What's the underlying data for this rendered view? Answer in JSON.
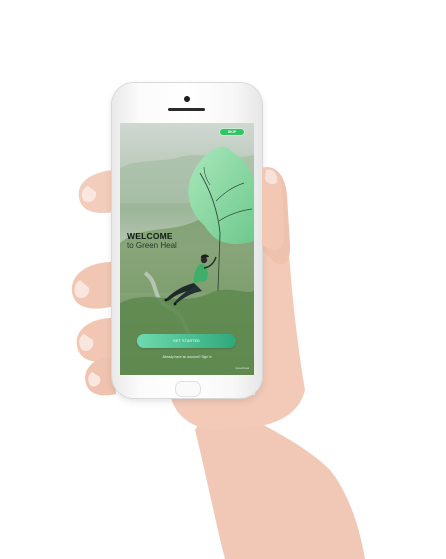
{
  "screen": {
    "skip_label": "SKIP",
    "welcome_title": "WELCOME",
    "welcome_subtitle": "to Green Heal",
    "cta_label": "GET STARTED",
    "signin_text": "Already have an account? Sign in",
    "brand_text": "GreenHeal"
  },
  "colors": {
    "accent": "#33c466",
    "leaf": "#8ed9a6",
    "cta_start": "#6fd9ad",
    "cta_end": "#2fa87d"
  }
}
